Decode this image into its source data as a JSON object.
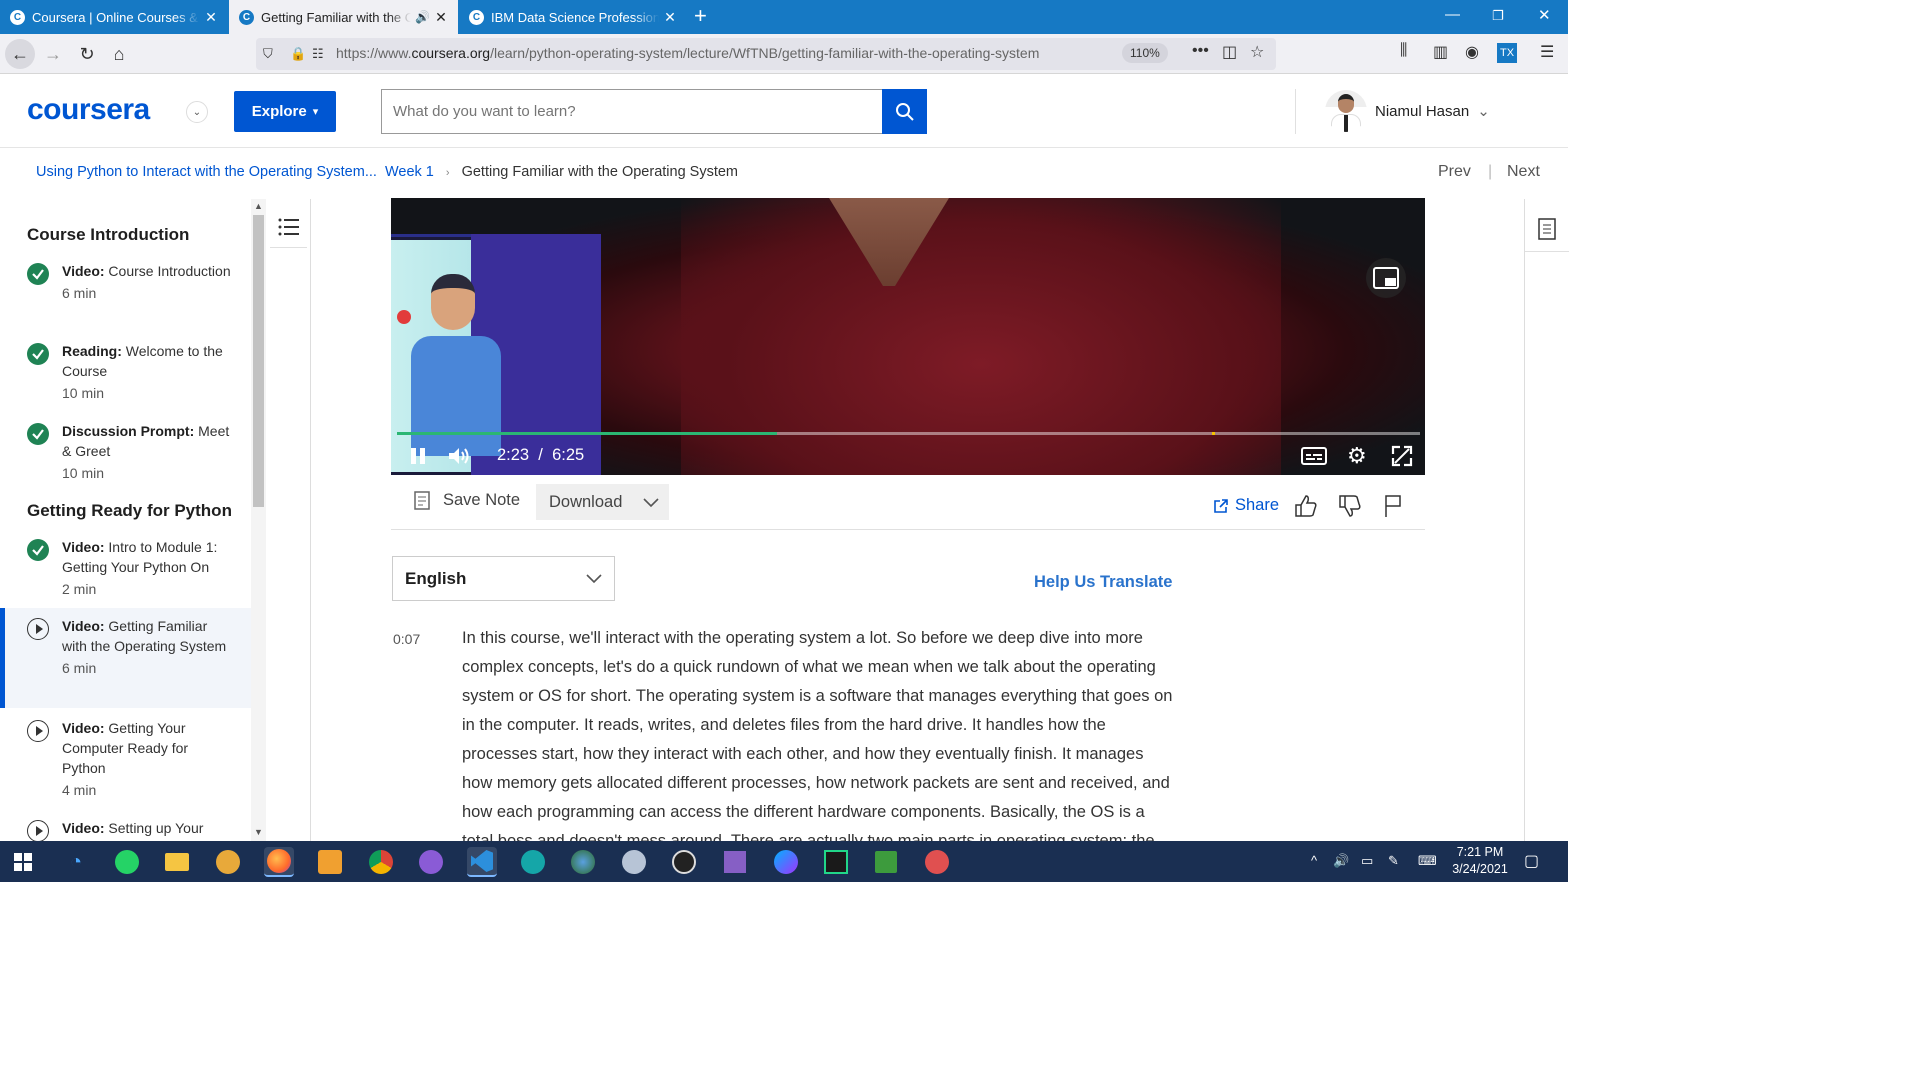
{
  "browser": {
    "tabs": [
      {
        "title": "Coursera | Online Courses & Credentials",
        "favicon": "C",
        "active": false
      },
      {
        "title": "Getting Familiar with the Operating System",
        "favicon": "C",
        "active": true
      },
      {
        "title": "IBM Data Science Professional Certificate",
        "favicon": "C",
        "active": false
      }
    ],
    "url_prefix": "https://www.",
    "url_domain": "coursera.org",
    "url_path": "/learn/python-operating-system/lecture/WfTNB/getting-familiar-with-the-operating-system",
    "zoom": "110%"
  },
  "header": {
    "logo": "coursera",
    "explore_label": "Explore",
    "search_placeholder": "What do you want to learn?",
    "user_name": "Niamul Hasan"
  },
  "breadcrumb": {
    "course": "Using Python to Interact with the Operating System...",
    "week": "Week 1",
    "current": "Getting Familiar with the Operating System",
    "prev": "Prev",
    "next": "Next"
  },
  "sidebar": {
    "sections": [
      {
        "title": "Course Introduction"
      },
      {
        "title": "Getting Ready for Python"
      }
    ],
    "items": [
      {
        "type": "Video:",
        "title": "Course Introduction",
        "duration": "6 min",
        "status": "done"
      },
      {
        "type": "Reading:",
        "title": "Welcome to the Course",
        "duration": "10 min",
        "status": "done"
      },
      {
        "type": "Discussion Prompt:",
        "title": "Meet & Greet",
        "duration": "10 min",
        "status": "done"
      },
      {
        "type": "Video:",
        "title": "Intro to Module 1: Getting Your Python On",
        "duration": "2 min",
        "status": "done"
      },
      {
        "type": "Video:",
        "title": "Getting Familiar with the Operating System",
        "duration": "6 min",
        "status": "active"
      },
      {
        "type": "Video:",
        "title": "Getting Your Computer Ready for Python",
        "duration": "4 min",
        "status": "todo"
      },
      {
        "type": "Video:",
        "title": "Setting up Your",
        "duration": "",
        "status": "todo"
      }
    ]
  },
  "video": {
    "current_time": "2:23",
    "separator": "/",
    "total_time": "6:25",
    "progress_fraction": 0.371,
    "marker_fraction": 0.797
  },
  "video_tools": {
    "save_note": "Save Note",
    "download": "Download",
    "share": "Share"
  },
  "transcript": {
    "language": "English",
    "help_translate": "Help Us Translate",
    "timestamp": "0:07",
    "text": "In this course, we'll interact with the operating system a lot. So before we deep dive into more complex concepts, let's do a quick rundown of what we mean when we talk about the operating system or OS for short. The operating system is a software that manages everything that goes on in the computer. It reads, writes, and deletes files from the hard drive. It handles how the processes start, how they interact with each other, and how they eventually finish. It manages how memory gets allocated different processes, how network packets are sent and received, and how each programming can access the different hardware components. Basically, the OS is a total boss and doesn't mess around. There are actually two main parts in operating system: the"
  },
  "taskbar": {
    "apps": [
      "start-icon",
      "task-view-icon",
      "whatsapp-icon",
      "file-explorer-icon",
      "tor-icon",
      "firefox-icon",
      "paint-icon",
      "chrome-icon",
      "github-icon",
      "vscode-icon",
      "arduino-icon",
      "earth-icon",
      "app-icon",
      "inkscape-icon",
      "visual-studio-icon",
      "messenger-icon",
      "pycharm-icon",
      "spreadsheet-icon",
      "app-icon-2"
    ],
    "time": "7:21 PM",
    "date": "3/24/2021"
  },
  "colors": {
    "brand": "#0056d2",
    "tabbar": "#1679c4",
    "progress": "#2bb673",
    "done": "#1f8354",
    "taskbar": "#1a2f52"
  }
}
